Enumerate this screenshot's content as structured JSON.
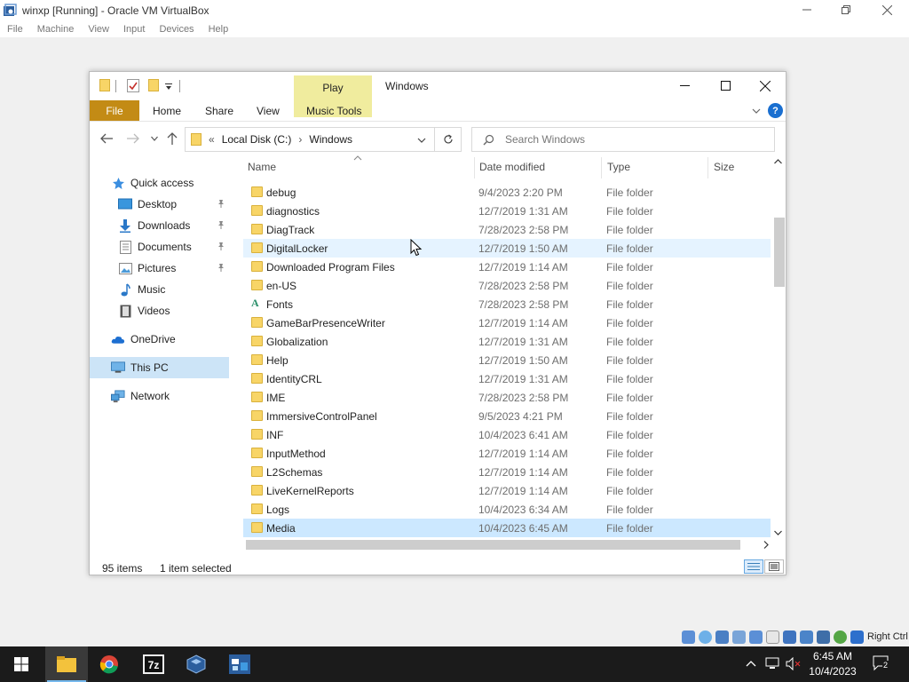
{
  "host": {
    "title": "winxp [Running] - Oracle VM VirtualBox",
    "menu": [
      "File",
      "Machine",
      "View",
      "Input",
      "Devices",
      "Help"
    ],
    "status_right": "Right Ctrl"
  },
  "explorer": {
    "title": "Windows",
    "contextual_tab": "Play",
    "ribbon_tabs": [
      "File",
      "Home",
      "Share",
      "View",
      "Music Tools"
    ],
    "address": {
      "overflow": "«",
      "crumbs": [
        "Local Disk (C:)",
        "Windows"
      ]
    },
    "search_placeholder": "Search Windows",
    "columns": [
      "Name",
      "Date modified",
      "Type",
      "Size"
    ],
    "nav": [
      {
        "label": "Quick access",
        "icon": "star-icon"
      },
      {
        "label": "Desktop",
        "icon": "desktop-icon",
        "pinned": true
      },
      {
        "label": "Downloads",
        "icon": "download-icon",
        "pinned": true
      },
      {
        "label": "Documents",
        "icon": "documents-icon",
        "pinned": true
      },
      {
        "label": "Pictures",
        "icon": "pictures-icon",
        "pinned": true
      },
      {
        "label": "Music",
        "icon": "music-icon"
      },
      {
        "label": "Videos",
        "icon": "videos-icon"
      },
      {
        "label": "OneDrive",
        "icon": "cloud-icon"
      },
      {
        "label": "This PC",
        "icon": "computer-icon",
        "selected": true
      },
      {
        "label": "Network",
        "icon": "network-icon"
      }
    ],
    "files": [
      {
        "name": "debug",
        "date": "9/4/2023 2:20 PM",
        "type": "File folder"
      },
      {
        "name": "diagnostics",
        "date": "12/7/2019 1:31 AM",
        "type": "File folder"
      },
      {
        "name": "DiagTrack",
        "date": "7/28/2023 2:58 PM",
        "type": "File folder"
      },
      {
        "name": "DigitalLocker",
        "date": "12/7/2019 1:50 AM",
        "type": "File folder",
        "hover": true
      },
      {
        "name": "Downloaded Program Files",
        "date": "12/7/2019 1:14 AM",
        "type": "File folder"
      },
      {
        "name": "en-US",
        "date": "7/28/2023 2:58 PM",
        "type": "File folder"
      },
      {
        "name": "Fonts",
        "date": "7/28/2023 2:58 PM",
        "type": "File folder",
        "icon": "fonts"
      },
      {
        "name": "GameBarPresenceWriter",
        "date": "12/7/2019 1:14 AM",
        "type": "File folder"
      },
      {
        "name": "Globalization",
        "date": "12/7/2019 1:31 AM",
        "type": "File folder"
      },
      {
        "name": "Help",
        "date": "12/7/2019 1:50 AM",
        "type": "File folder"
      },
      {
        "name": "IdentityCRL",
        "date": "12/7/2019 1:31 AM",
        "type": "File folder"
      },
      {
        "name": "IME",
        "date": "7/28/2023 2:58 PM",
        "type": "File folder"
      },
      {
        "name": "ImmersiveControlPanel",
        "date": "9/5/2023 4:21 PM",
        "type": "File folder"
      },
      {
        "name": "INF",
        "date": "10/4/2023 6:41 AM",
        "type": "File folder"
      },
      {
        "name": "InputMethod",
        "date": "12/7/2019 1:14 AM",
        "type": "File folder"
      },
      {
        "name": "L2Schemas",
        "date": "12/7/2019 1:14 AM",
        "type": "File folder"
      },
      {
        "name": "LiveKernelReports",
        "date": "12/7/2019 1:14 AM",
        "type": "File folder"
      },
      {
        "name": "Logs",
        "date": "10/4/2023 6:34 AM",
        "type": "File folder"
      },
      {
        "name": "Media",
        "date": "10/4/2023 6:45 AM",
        "type": "File folder",
        "selected": true
      }
    ],
    "status": {
      "count": "95 items",
      "selection": "1 item selected"
    }
  },
  "taskbar": {
    "time": "6:45 AM",
    "date": "10/4/2023",
    "notifications": "2"
  }
}
